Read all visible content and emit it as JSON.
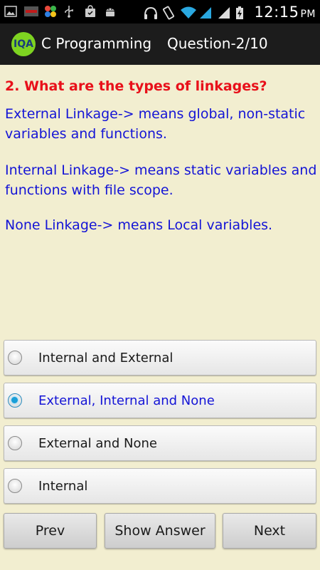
{
  "status_bar": {
    "time": "12:15",
    "ampm": "PM",
    "icons": [
      "image-icon",
      "news-app-icon",
      "flower-app-icon",
      "usb-icon",
      "shopping-bag-icon",
      "android-icon",
      "headphones-icon",
      "vibrate-icon",
      "wifi-icon",
      "signal-icon",
      "signal-icon",
      "battery-charging-icon"
    ]
  },
  "action_bar": {
    "logo_text": "IQA",
    "title": "C Programming",
    "question_count": "Question-2/10"
  },
  "question": {
    "heading": "2. What are the types of linkages?",
    "paragraphs": [
      "External Linkage-> means global, non-static variables and functions.",
      "Internal Linkage-> means static variables and functions with file scope.",
      "None Linkage-> means Local variables."
    ]
  },
  "options": [
    {
      "label": "Internal and External",
      "selected": false
    },
    {
      "label": "External, Internal and None",
      "selected": true
    },
    {
      "label": "External and None",
      "selected": false
    },
    {
      "label": "Internal",
      "selected": false
    }
  ],
  "buttons": {
    "prev": "Prev",
    "show_answer": "Show Answer",
    "next": "Next"
  },
  "colors": {
    "background": "#f2eed0",
    "heading": "#e8101a",
    "body_text": "#1414d6",
    "radio_checked": "#1a9fd8",
    "logo_bg": "#7ed321"
  }
}
